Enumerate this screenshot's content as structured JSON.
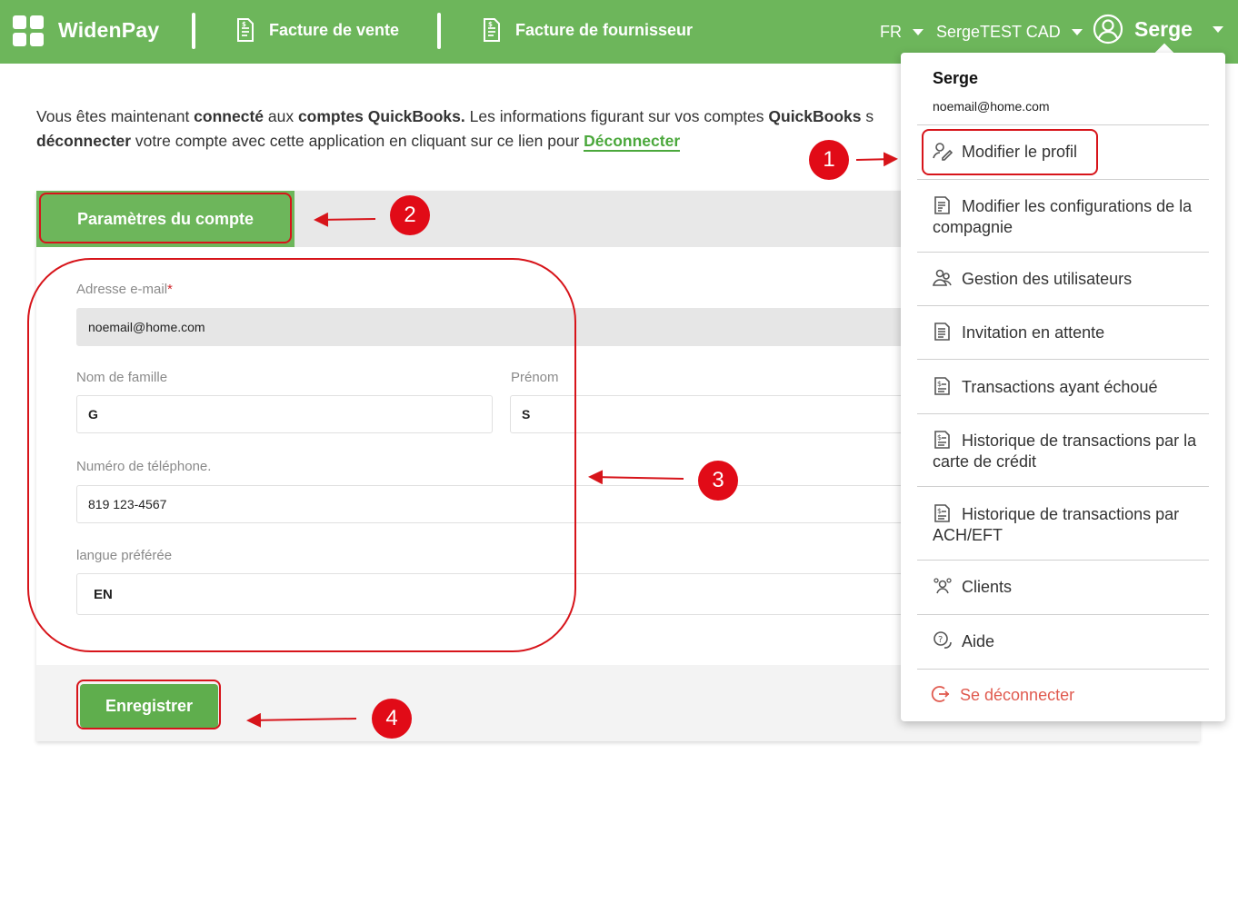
{
  "brand": "WidenPay",
  "nav": {
    "sales_invoice": "Facture de vente",
    "supplier_invoice": "Facture de fournisseur",
    "language": "FR",
    "company": "SergeTEST CAD",
    "user": "Serge"
  },
  "intro": {
    "p1": "Vous êtes maintenant ",
    "b1": "connecté",
    "p2": " aux ",
    "b2": "comptes QuickBooks.",
    "p3": " Les informations figurant sur vos comptes ",
    "b3": "QuickBooks",
    "p4": " s",
    "b4": "déconnecter",
    "p5": " votre compte avec cette application en cliquant sur ce lien pour ",
    "link": "Déconnecter"
  },
  "tab": {
    "account_settings": "Paramètres du compte"
  },
  "form": {
    "email_label": "Adresse e-mail",
    "required_mark": "*",
    "email_value": "noemail@home.com",
    "lastname_label": "Nom de famille",
    "lastname_value": "G",
    "firstname_label": "Prénom",
    "firstname_value": "S",
    "phone_label": "Numéro de téléphone.",
    "phone_value": "819 123-4567",
    "language_label": "langue préférée",
    "language_value": "EN"
  },
  "save_label": "Enregistrer",
  "menu": {
    "name": "Serge",
    "email": "noemail@home.com",
    "items": [
      {
        "label": "Modifier le profil",
        "icon": "user-edit-icon"
      },
      {
        "label": "Modifier les configurations de la compagnie",
        "icon": "document-edit-icon"
      },
      {
        "label": "Gestion des utilisateurs",
        "icon": "users-icon"
      },
      {
        "label": "Invitation en attente",
        "icon": "document-icon"
      },
      {
        "label": "Transactions ayant échoué",
        "icon": "invoice-icon"
      },
      {
        "label": "Historique de transactions par la carte de crédit",
        "icon": "invoice-icon"
      },
      {
        "label": "Historique de transactions par ACH/EFT",
        "icon": "invoice-icon"
      },
      {
        "label": "Clients",
        "icon": "clients-icon"
      },
      {
        "label": "Aide",
        "icon": "help-chat-icon"
      },
      {
        "label": "Se déconnecter",
        "icon": "logout-icon"
      }
    ]
  },
  "annotations": [
    "1",
    "2",
    "3",
    "4"
  ],
  "colors": {
    "topbar": "#6db65b",
    "button": "#5fae4d",
    "annotation": "#d7141a",
    "link": "#4ba83c",
    "logout": "#e05a4f"
  }
}
